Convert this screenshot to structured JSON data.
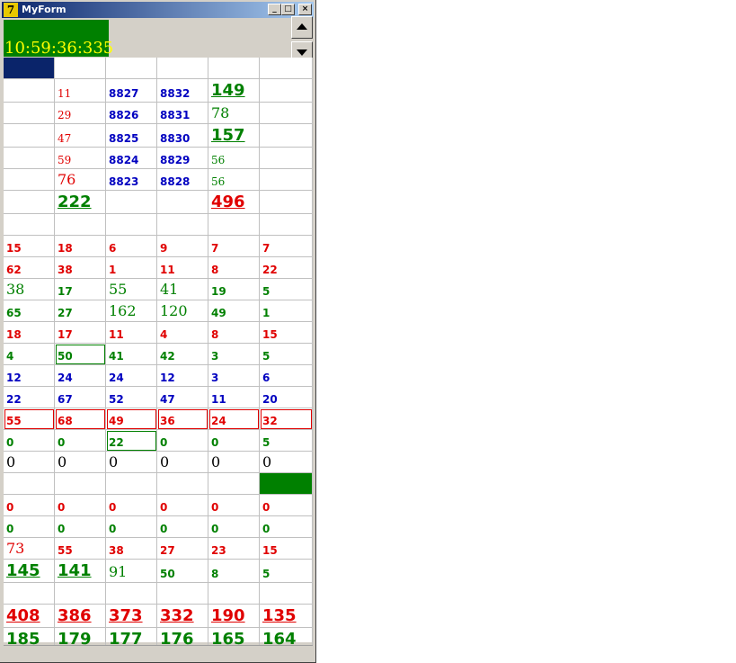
{
  "window": {
    "title": "MyForm",
    "icon": "delphi-icon",
    "minimize": "_",
    "maximize": "□",
    "close": "×"
  },
  "clock": {
    "text": "10:59:36:335",
    "bg": "#008000",
    "color": "#ffff00"
  },
  "colors": {
    "red": "#e00000",
    "green": "#008000",
    "blue": "#0000c0",
    "navy": "#0a246a"
  },
  "grid": {
    "columns": 6,
    "rows": [
      [
        {
          "t": "",
          "bg": "#0a246a"
        },
        {
          "t": ""
        },
        {
          "t": ""
        },
        {
          "t": ""
        },
        {
          "t": ""
        },
        {
          "t": ""
        }
      ],
      [
        {
          "t": ""
        },
        {
          "t": "11",
          "c": "r",
          "f": "sm"
        },
        {
          "t": "8827",
          "c": "b",
          "f": "s"
        },
        {
          "t": "8832",
          "c": "b",
          "f": "s"
        },
        {
          "t": "149",
          "c": "g",
          "f": "l"
        },
        {
          "t": ""
        }
      ],
      [
        {
          "t": ""
        },
        {
          "t": "29",
          "c": "r",
          "f": "sm"
        },
        {
          "t": "8826",
          "c": "b",
          "f": "s"
        },
        {
          "t": "8831",
          "c": "b",
          "f": "s"
        },
        {
          "t": "78",
          "c": "g",
          "f": "m"
        },
        {
          "t": ""
        }
      ],
      [
        {
          "t": ""
        },
        {
          "t": "47",
          "c": "r",
          "f": "sm"
        },
        {
          "t": "8825",
          "c": "b",
          "f": "s"
        },
        {
          "t": "8830",
          "c": "b",
          "f": "s"
        },
        {
          "t": "157",
          "c": "g",
          "f": "l"
        },
        {
          "t": ""
        }
      ],
      [
        {
          "t": ""
        },
        {
          "t": "59",
          "c": "r",
          "f": "sm"
        },
        {
          "t": "8824",
          "c": "b",
          "f": "s"
        },
        {
          "t": "8829",
          "c": "b",
          "f": "s"
        },
        {
          "t": "56",
          "c": "g",
          "f": "sm"
        },
        {
          "t": ""
        }
      ],
      [
        {
          "t": ""
        },
        {
          "t": "76",
          "c": "r",
          "f": "m"
        },
        {
          "t": "8823",
          "c": "b",
          "f": "s"
        },
        {
          "t": "8828",
          "c": "b",
          "f": "s"
        },
        {
          "t": "56",
          "c": "g",
          "f": "sm"
        },
        {
          "t": ""
        }
      ],
      [
        {
          "t": ""
        },
        {
          "t": "222",
          "c": "g",
          "f": "l"
        },
        {
          "t": ""
        },
        {
          "t": ""
        },
        {
          "t": "496",
          "c": "r",
          "f": "l"
        },
        {
          "t": ""
        }
      ],
      [
        {
          "t": ""
        },
        {
          "t": ""
        },
        {
          "t": ""
        },
        {
          "t": ""
        },
        {
          "t": ""
        },
        {
          "t": ""
        }
      ],
      [
        {
          "t": "15",
          "c": "r",
          "f": "s"
        },
        {
          "t": "18",
          "c": "r",
          "f": "s"
        },
        {
          "t": "6",
          "c": "r",
          "f": "s"
        },
        {
          "t": "9",
          "c": "r",
          "f": "s"
        },
        {
          "t": "7",
          "c": "r",
          "f": "s"
        },
        {
          "t": "7",
          "c": "r",
          "f": "s"
        }
      ],
      [
        {
          "t": "62",
          "c": "r",
          "f": "s"
        },
        {
          "t": "38",
          "c": "r",
          "f": "s"
        },
        {
          "t": "1",
          "c": "r",
          "f": "s"
        },
        {
          "t": "11",
          "c": "r",
          "f": "s"
        },
        {
          "t": "8",
          "c": "r",
          "f": "s"
        },
        {
          "t": "22",
          "c": "r",
          "f": "s"
        }
      ],
      [
        {
          "t": "38",
          "c": "g",
          "f": "m"
        },
        {
          "t": "17",
          "c": "g",
          "f": "s"
        },
        {
          "t": "55",
          "c": "g",
          "f": "m"
        },
        {
          "t": "41",
          "c": "g",
          "f": "m"
        },
        {
          "t": "19",
          "c": "g",
          "f": "s"
        },
        {
          "t": "5",
          "c": "g",
          "f": "s"
        }
      ],
      [
        {
          "t": "65",
          "c": "g",
          "f": "s"
        },
        {
          "t": "27",
          "c": "g",
          "f": "s"
        },
        {
          "t": "162",
          "c": "g",
          "f": "m"
        },
        {
          "t": "120",
          "c": "g",
          "f": "m"
        },
        {
          "t": "49",
          "c": "g",
          "f": "s"
        },
        {
          "t": "1",
          "c": "g",
          "f": "s"
        }
      ],
      [
        {
          "t": "18",
          "c": "r",
          "f": "s"
        },
        {
          "t": "17",
          "c": "r",
          "f": "s"
        },
        {
          "t": "11",
          "c": "r",
          "f": "s"
        },
        {
          "t": "4",
          "c": "r",
          "f": "s"
        },
        {
          "t": "8",
          "c": "r",
          "f": "s"
        },
        {
          "t": "15",
          "c": "r",
          "f": "s"
        }
      ],
      [
        {
          "t": "4",
          "c": "g",
          "f": "s"
        },
        {
          "t": "50",
          "c": "g",
          "f": "s",
          "box": "#008000"
        },
        {
          "t": "41",
          "c": "g",
          "f": "s"
        },
        {
          "t": "42",
          "c": "g",
          "f": "s"
        },
        {
          "t": "3",
          "c": "g",
          "f": "s"
        },
        {
          "t": "5",
          "c": "g",
          "f": "s"
        }
      ],
      [
        {
          "t": "12",
          "c": "b",
          "f": "s"
        },
        {
          "t": "24",
          "c": "b",
          "f": "s"
        },
        {
          "t": "24",
          "c": "b",
          "f": "s"
        },
        {
          "t": "12",
          "c": "b",
          "f": "s"
        },
        {
          "t": "3",
          "c": "b",
          "f": "s"
        },
        {
          "t": "6",
          "c": "b",
          "f": "s"
        }
      ],
      [
        {
          "t": "22",
          "c": "b",
          "f": "s"
        },
        {
          "t": "67",
          "c": "b",
          "f": "s"
        },
        {
          "t": "52",
          "c": "b",
          "f": "s"
        },
        {
          "t": "47",
          "c": "b",
          "f": "s"
        },
        {
          "t": "11",
          "c": "b",
          "f": "s"
        },
        {
          "t": "20",
          "c": "b",
          "f": "s"
        }
      ],
      [
        {
          "t": "55",
          "c": "r",
          "f": "s",
          "box": "#e00000"
        },
        {
          "t": "68",
          "c": "r",
          "f": "s",
          "box": "#e00000"
        },
        {
          "t": "49",
          "c": "r",
          "f": "s",
          "box": "#e00000"
        },
        {
          "t": "36",
          "c": "r",
          "f": "s",
          "box": "#e00000"
        },
        {
          "t": "24",
          "c": "r",
          "f": "s",
          "box": "#e00000"
        },
        {
          "t": "32",
          "c": "r",
          "f": "s",
          "box": "#e00000"
        }
      ],
      [
        {
          "t": "0",
          "c": "g",
          "f": "s"
        },
        {
          "t": "0",
          "c": "g",
          "f": "s"
        },
        {
          "t": "22",
          "c": "g",
          "f": "s",
          "box": "#008000"
        },
        {
          "t": "0",
          "c": "g",
          "f": "s"
        },
        {
          "t": "0",
          "c": "g",
          "f": "s"
        },
        {
          "t": "5",
          "c": "g",
          "f": "s"
        }
      ],
      [
        {
          "t": "0",
          "c": "k",
          "f": "m"
        },
        {
          "t": "0",
          "c": "k",
          "f": "m"
        },
        {
          "t": "0",
          "c": "k",
          "f": "m"
        },
        {
          "t": "0",
          "c": "k",
          "f": "m"
        },
        {
          "t": "0",
          "c": "k",
          "f": "m"
        },
        {
          "t": "0",
          "c": "k",
          "f": "m"
        }
      ],
      [
        {
          "t": ""
        },
        {
          "t": ""
        },
        {
          "t": ""
        },
        {
          "t": ""
        },
        {
          "t": ""
        },
        {
          "t": "",
          "bg": "#008000"
        }
      ],
      [
        {
          "t": "0",
          "c": "r",
          "f": "s"
        },
        {
          "t": "0",
          "c": "r",
          "f": "s"
        },
        {
          "t": "0",
          "c": "r",
          "f": "s"
        },
        {
          "t": "0",
          "c": "r",
          "f": "s"
        },
        {
          "t": "0",
          "c": "r",
          "f": "s"
        },
        {
          "t": "0",
          "c": "r",
          "f": "s"
        }
      ],
      [
        {
          "t": "0",
          "c": "g",
          "f": "s"
        },
        {
          "t": "0",
          "c": "g",
          "f": "s"
        },
        {
          "t": "0",
          "c": "g",
          "f": "s"
        },
        {
          "t": "0",
          "c": "g",
          "f": "s"
        },
        {
          "t": "0",
          "c": "g",
          "f": "s"
        },
        {
          "t": "0",
          "c": "g",
          "f": "s"
        }
      ],
      [
        {
          "t": "73",
          "c": "r",
          "f": "m"
        },
        {
          "t": "55",
          "c": "r",
          "f": "s"
        },
        {
          "t": "38",
          "c": "r",
          "f": "s"
        },
        {
          "t": "27",
          "c": "r",
          "f": "s"
        },
        {
          "t": "23",
          "c": "r",
          "f": "s"
        },
        {
          "t": "15",
          "c": "r",
          "f": "s"
        }
      ],
      [
        {
          "t": "145",
          "c": "g",
          "f": "l"
        },
        {
          "t": "141",
          "c": "g",
          "f": "l"
        },
        {
          "t": "91",
          "c": "g",
          "f": "m"
        },
        {
          "t": "50",
          "c": "g",
          "f": "s"
        },
        {
          "t": "8",
          "c": "g",
          "f": "s"
        },
        {
          "t": "5",
          "c": "g",
          "f": "s"
        }
      ],
      [
        {
          "t": ""
        },
        {
          "t": ""
        },
        {
          "t": ""
        },
        {
          "t": ""
        },
        {
          "t": ""
        },
        {
          "t": ""
        }
      ],
      [
        {
          "t": "408",
          "c": "r",
          "f": "l"
        },
        {
          "t": "386",
          "c": "r",
          "f": "l"
        },
        {
          "t": "373",
          "c": "r",
          "f": "l"
        },
        {
          "t": "332",
          "c": "r",
          "f": "l"
        },
        {
          "t": "190",
          "c": "r",
          "f": "l"
        },
        {
          "t": "135",
          "c": "r",
          "f": "l"
        }
      ],
      [
        {
          "t": "185",
          "c": "g",
          "f": "l"
        },
        {
          "t": "179",
          "c": "g",
          "f": "l"
        },
        {
          "t": "177",
          "c": "g",
          "f": "l"
        },
        {
          "t": "176",
          "c": "g",
          "f": "l"
        },
        {
          "t": "165",
          "c": "g",
          "f": "l"
        },
        {
          "t": "164",
          "c": "g",
          "f": "l"
        }
      ]
    ]
  }
}
